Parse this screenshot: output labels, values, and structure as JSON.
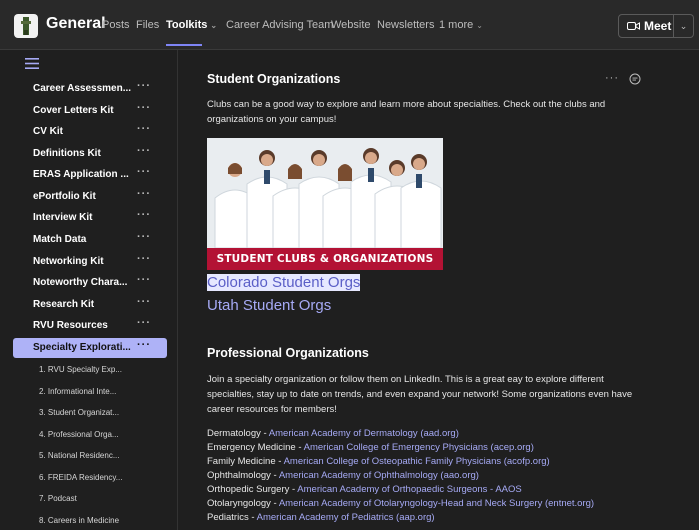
{
  "header": {
    "channel_title": "General",
    "tabs": [
      {
        "label": "Posts"
      },
      {
        "label": "Files"
      },
      {
        "label": "Toolkits"
      },
      {
        "label": "Career Advising Team"
      },
      {
        "label": "Website"
      },
      {
        "label": "Newsletters"
      },
      {
        "label": "1 more"
      }
    ],
    "meet_label": "Meet"
  },
  "sidebar": {
    "items": [
      {
        "label": "Career Assessmen..."
      },
      {
        "label": "Cover Letters Kit"
      },
      {
        "label": "CV Kit"
      },
      {
        "label": "Definitions Kit"
      },
      {
        "label": "ERAS Application ..."
      },
      {
        "label": "ePortfolio Kit"
      },
      {
        "label": "Interview Kit"
      },
      {
        "label": "Match Data"
      },
      {
        "label": "Networking Kit"
      },
      {
        "label": "Noteworthy Chara..."
      },
      {
        "label": "Research Kit"
      },
      {
        "label": "RVU Resources"
      },
      {
        "label": "Specialty Explorati..."
      }
    ],
    "sub_items": [
      {
        "label": "1. RVU Specialty Exp..."
      },
      {
        "label": "2. Informational Inte..."
      },
      {
        "label": "3. Student Organizat..."
      },
      {
        "label": "4. Professional Orga..."
      },
      {
        "label": "5. National Residenc..."
      },
      {
        "label": "6. FREIDA Residency..."
      },
      {
        "label": "7. Podcast"
      },
      {
        "label": "8. Careers in Medicine"
      }
    ]
  },
  "main": {
    "student_orgs": {
      "title": "Student Organizations",
      "description": "Clubs can be a good way to explore and learn more about specialties. Check out the clubs and organizations on your campus!",
      "image_banner": "STUDENT CLUBS & ORGANIZATIONS",
      "links": [
        {
          "label": "Colorado Student Orgs"
        },
        {
          "label": "Utah Student Orgs"
        }
      ]
    },
    "professional_orgs": {
      "title": "Professional Organizations",
      "description": "Join a specialty organization or follow them on LinkedIn. This is a great eay to explore different specialties, stay up to date on trends, and even expand your network! Some organizations even have career resources for members!",
      "list": [
        {
          "specialty": "Dermatology",
          "org": "American Academy of Dermatology (aad.org)"
        },
        {
          "specialty": "Emergency Medicine",
          "org": "American College of Emergency Physicians (acep.org)"
        },
        {
          "specialty": "Family Medicine",
          "org": "American College of Osteopathic Family Physicians (acofp.org)"
        },
        {
          "specialty": "Ophthalmology",
          "org": "American Academy of Ophthalmology (aao.org)"
        },
        {
          "specialty": "Orthopedic Surgery",
          "org": "American Academy of Orthopaedic Surgeons - AAOS"
        },
        {
          "specialty": "Otolaryngology",
          "org": "American Academy of Otolaryngology-Head and Neck Surgery (entnet.org)"
        },
        {
          "specialty": "Pediatrics",
          "org": "American Academy of Pediatrics (aap.org)"
        }
      ]
    }
  },
  "colors": {
    "accent": "#7f85f5",
    "link": "#a6aaf5",
    "selected_nav": "#aeb2f7",
    "banner_red": "#b31234"
  },
  "icons": {
    "logo": "team-logo-icon",
    "meet": "video-camera-icon",
    "menu": "hamburger-menu-icon",
    "comment": "comment-icon"
  }
}
